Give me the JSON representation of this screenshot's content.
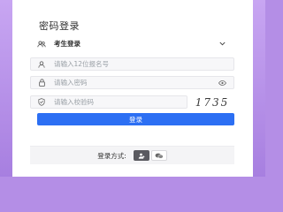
{
  "title": "密码登录",
  "role_select": {
    "value": "考生登录"
  },
  "reg_number": {
    "placeholder": "请输入12位报名号"
  },
  "password": {
    "placeholder": "请输入密码"
  },
  "captcha": {
    "placeholder": "请输入校验码",
    "image_text": "1735"
  },
  "login_button": "登录",
  "login_method": {
    "label": "登录方式:"
  },
  "colors": {
    "accent": "#2c6ff3",
    "background": "#b48ee6"
  }
}
